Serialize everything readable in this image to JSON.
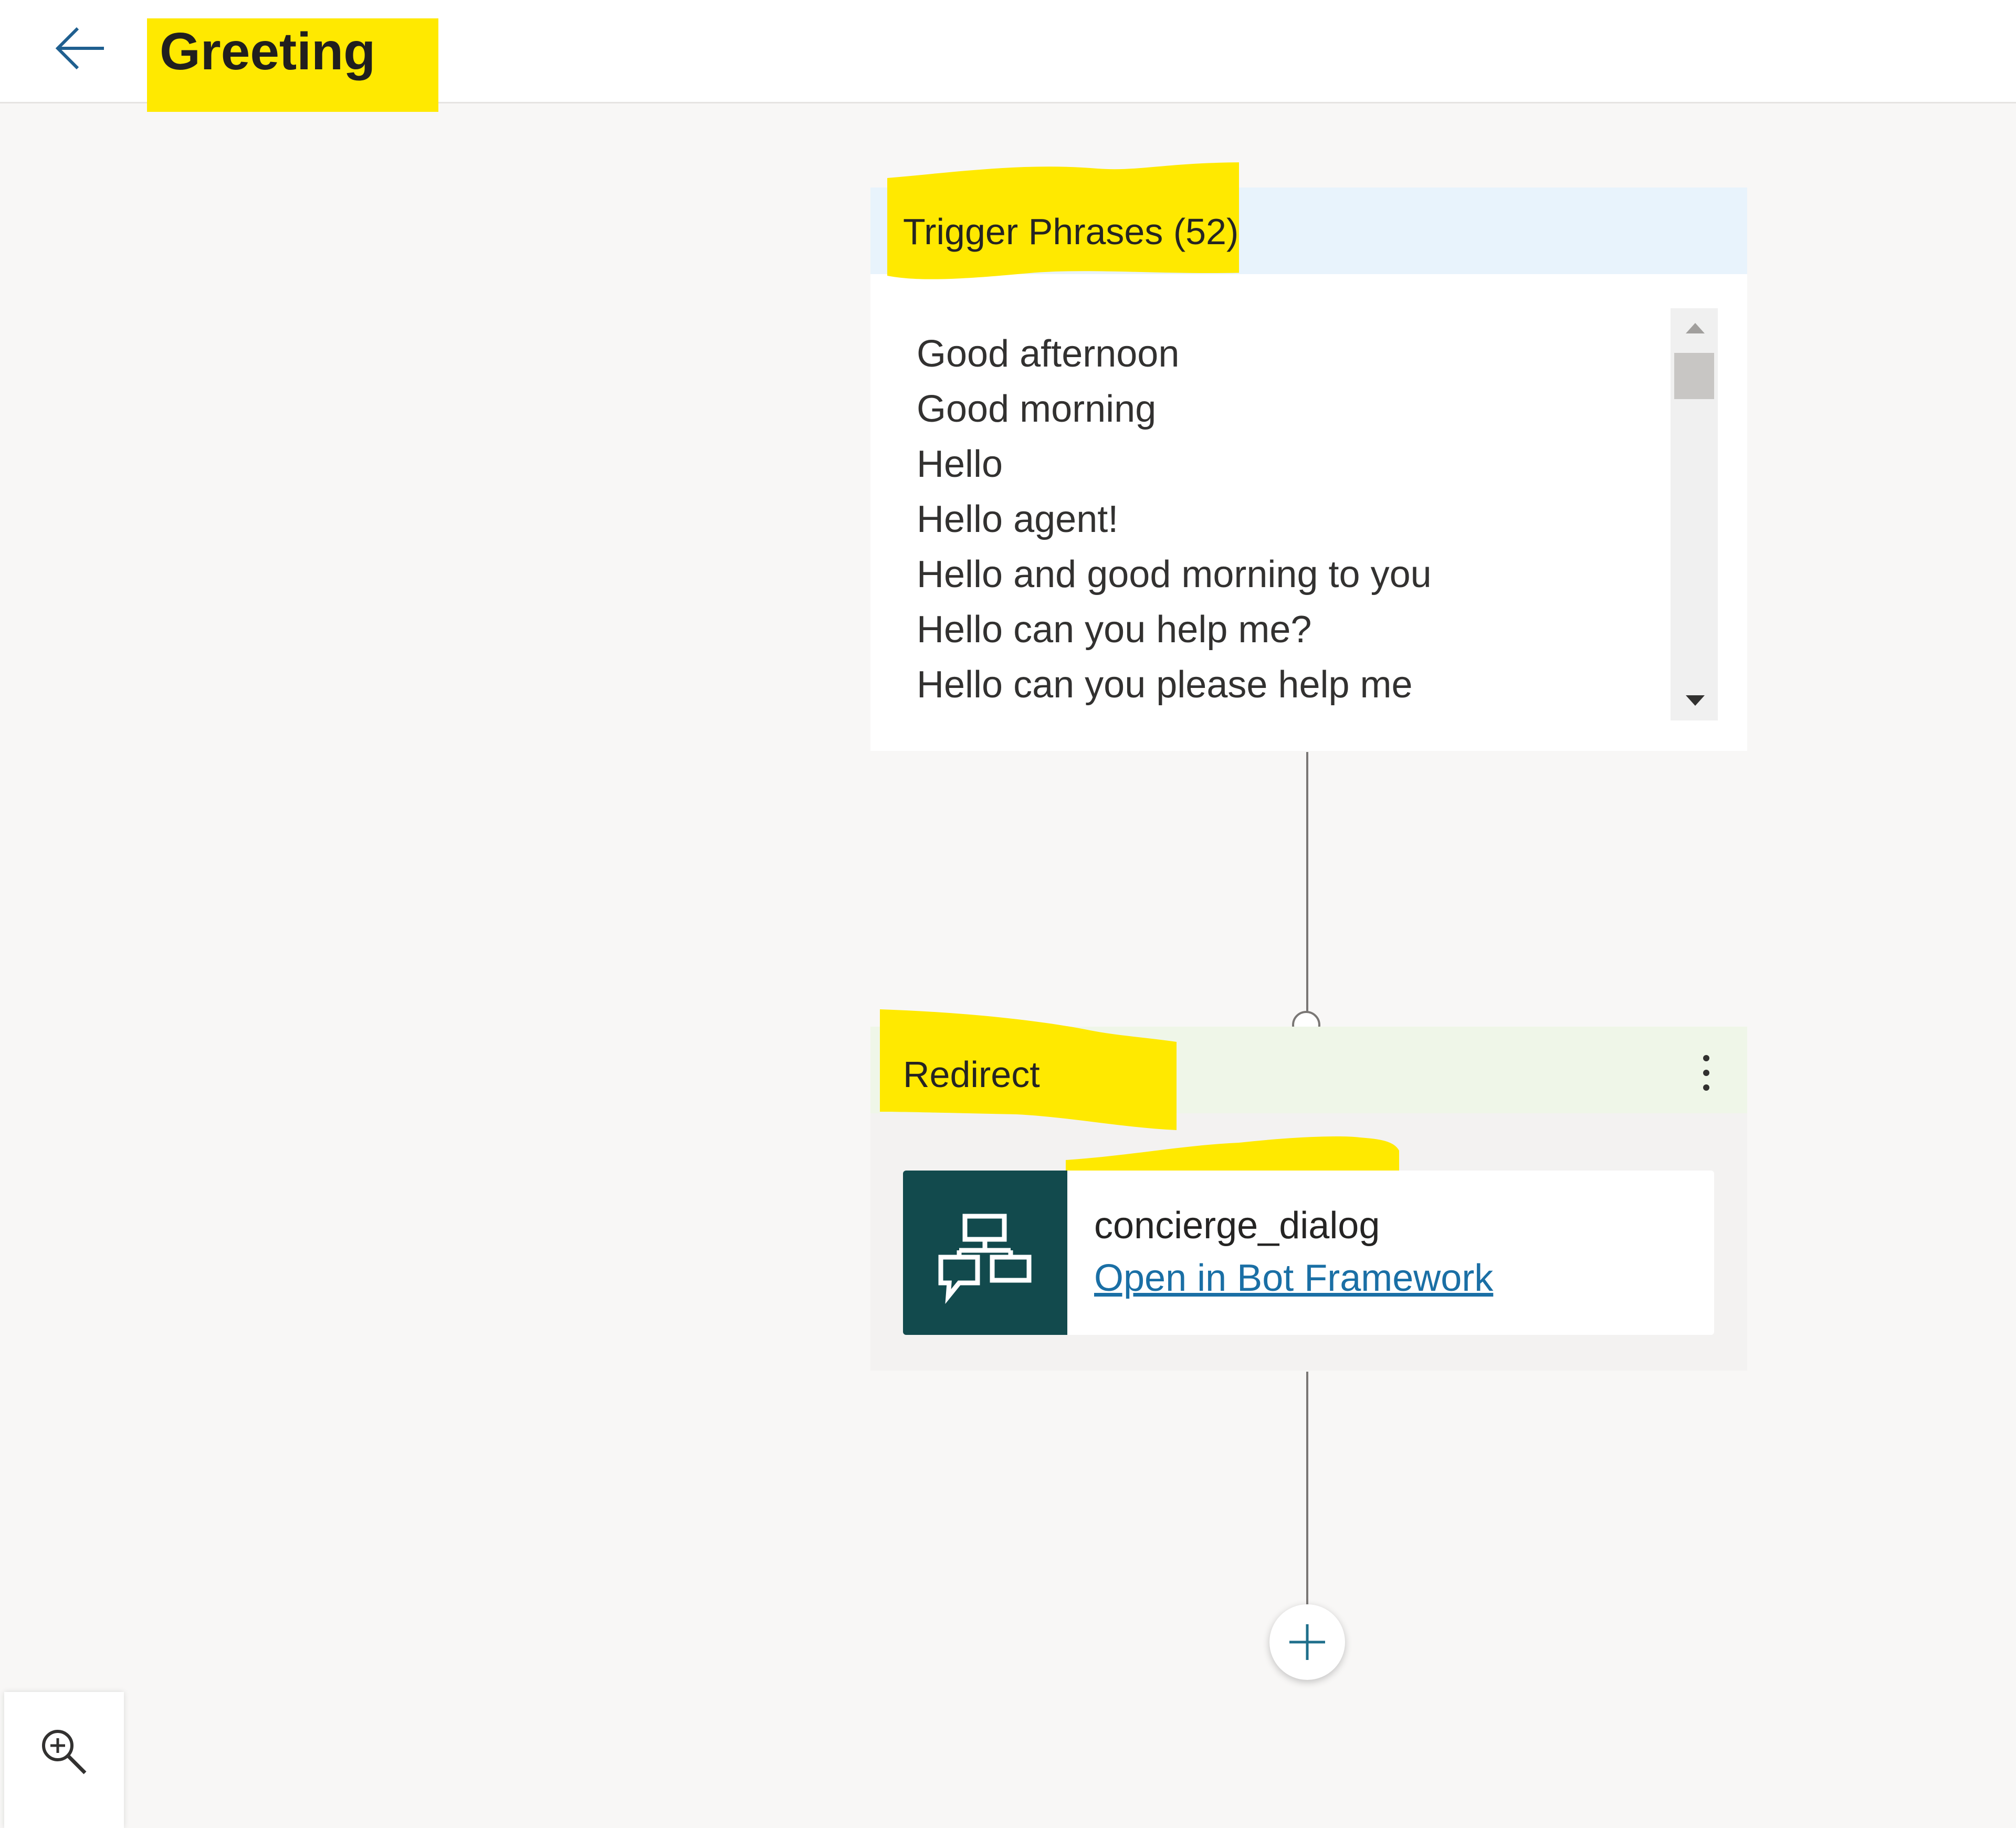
{
  "header": {
    "title": "Greeting",
    "back_icon": "arrow-left-icon"
  },
  "trigger_card": {
    "title": "Trigger Phrases (52)",
    "phrases": [
      "Good afternoon",
      "Good morning",
      "Hello",
      "Hello agent!",
      "Hello and good morning to you",
      "Hello can you help me?",
      "Hello can you please help me"
    ]
  },
  "redirect_card": {
    "title": "Redirect",
    "more_icon": "more-vertical-icon",
    "dialog_name": "concierge_dialog",
    "dialog_link": "Open in Bot Framework",
    "dialog_icon": "dialog-flow-icon"
  },
  "canvas": {
    "add_icon": "plus-icon",
    "zoom_icon": "zoom-in-icon"
  },
  "colors": {
    "highlight": "#ffe900",
    "trigger_header": "#e8f3fc",
    "redirect_header": "#eff6e8",
    "dialog_icon_bg": "#124a4d",
    "link": "#1a6fa5"
  }
}
